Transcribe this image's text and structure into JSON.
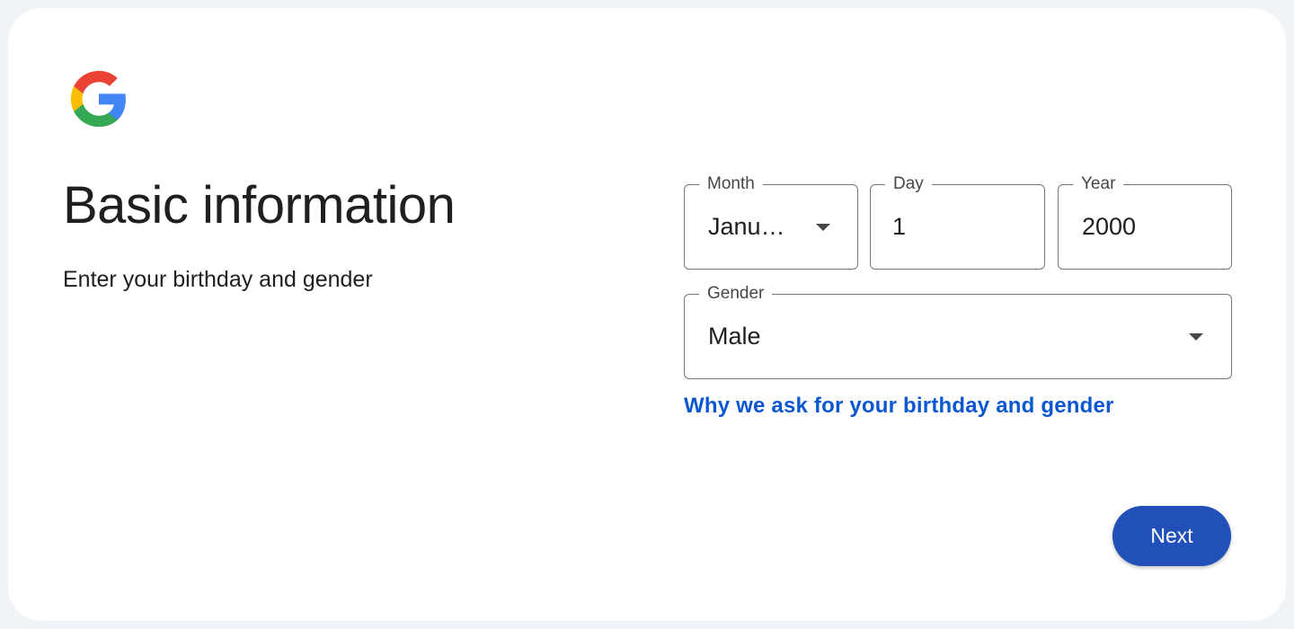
{
  "logo": {
    "icon": "google-g-icon",
    "colors": {
      "red": "#ea4335",
      "yellow": "#fbbc05",
      "green": "#34a853",
      "blue": "#4285f4"
    }
  },
  "page": {
    "title": "Basic information",
    "subtitle": "Enter your birthday and gender"
  },
  "birthday": {
    "month": {
      "label": "Month",
      "value": "Janu…",
      "icon": "caret-down-icon"
    },
    "day": {
      "label": "Day",
      "value": "1"
    },
    "year": {
      "label": "Year",
      "value": "2000"
    }
  },
  "gender": {
    "label": "Gender",
    "value": "Male",
    "icon": "caret-down-icon"
  },
  "why_link": "Why we ask for your birthday and gender",
  "next_button": "Next",
  "colors": {
    "accent": "#0b57d0",
    "button": "#2050b8",
    "background": "#f0f4f9"
  }
}
